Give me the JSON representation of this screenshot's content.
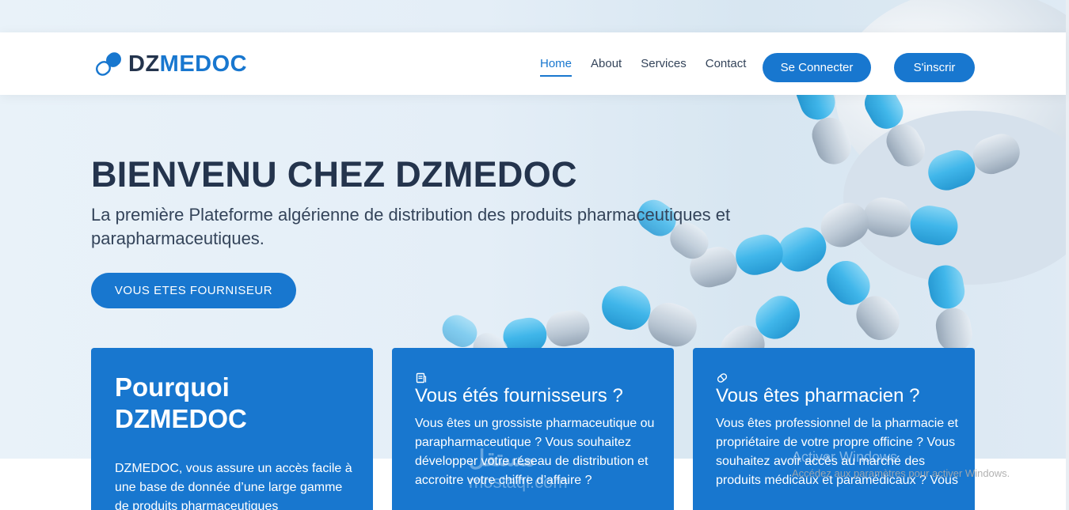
{
  "brand": {
    "part1": "DZ",
    "part2": "MEDOC",
    "accent_color": "#1877cf",
    "dark_color": "#24344d",
    "icon": "pill-capsule-icon"
  },
  "nav": {
    "items": [
      "Home",
      "About",
      "Services",
      "Contact"
    ],
    "active": "Home"
  },
  "buttons": {
    "connect": "Se Connecter",
    "signup": "S'inscrir"
  },
  "hero": {
    "title": "BIENVENU CHEZ DZMEDOC",
    "subtitle": "La première Plateforme algérienne de distribution des produits pharmaceutiques et parapharmaceutiques.",
    "cta": "VOUS ETES FOURNISEUR"
  },
  "cards": [
    {
      "title": "Pourquoi DZMEDOC",
      "text": "DZMEDOC, vous assure un accès facile à une base de donnée d’une large gamme de produits pharmaceutiques"
    },
    {
      "icon": "document-icon",
      "title": "Vous étés fournisseurs ?",
      "text": "Vous êtes un grossiste pharmaceutique ou parapharmaceutique ? Vous souhaitez développer votre réseau de distribution et accroitre votre chiffre d’affaire ?"
    },
    {
      "icon": "pill-icon",
      "title": "Vous êtes pharmacien ?",
      "text": "Vous êtes professionnel de la pharmacie et propriétaire de votre propre officine ? Vous souhaitez avoir accès au marché des produits médicaux et paramédicaux ? Vous"
    }
  ],
  "watermarks": {
    "windows_line1": "Activer Windows",
    "windows_line2": "Accédez aux paramètres pour activer Windows.",
    "mostaql_ar": "مستقل",
    "mostaql_en": "mostaql.com"
  }
}
